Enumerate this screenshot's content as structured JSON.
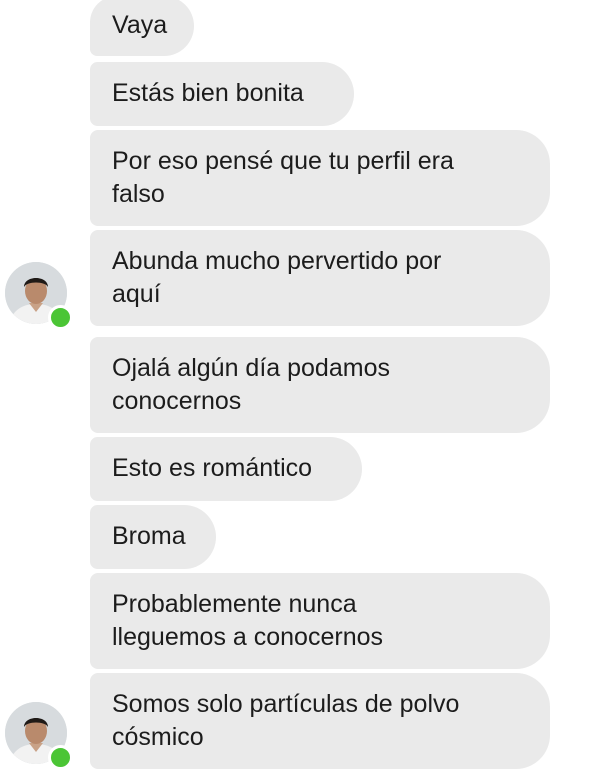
{
  "messages": [
    {
      "text": "Vaya"
    },
    {
      "text": "Estás bien bonita"
    },
    {
      "text": "Por eso pensé que tu perfil era\nfalso"
    },
    {
      "text": "Abunda mucho pervertido por\naquí"
    },
    {
      "text": "Ojalá algún día podamos\nconocernos"
    },
    {
      "text": "Esto es romántico"
    },
    {
      "text": "Broma"
    },
    {
      "text": "Probablemente nunca\nlleguemos a conocernos"
    },
    {
      "text": "Somos solo partículas de polvo\ncósmico"
    }
  ],
  "colors": {
    "bubble": "#eaeaea",
    "text": "#1c1c1c",
    "online_dot": "#4bc535"
  }
}
